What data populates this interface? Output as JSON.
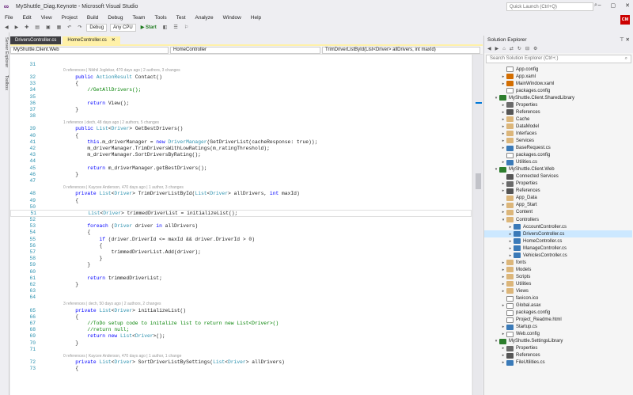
{
  "window": {
    "title": "MyShuttle_Diag.Keynote - Microsoft Visual Studio",
    "quick_launch_placeholder": "Quick Launch (Ctrl+Q)",
    "user_initials": "CM"
  },
  "menu": [
    "File",
    "Edit",
    "View",
    "Project",
    "Build",
    "Debug",
    "Team",
    "Tools",
    "Test",
    "Analyze",
    "Window",
    "Help"
  ],
  "toolbar": {
    "config": "Debug",
    "platform": "Any CPU",
    "start_label": "Start"
  },
  "side_tabs": [
    "Server Explorer",
    "Toolbox"
  ],
  "tabs": [
    {
      "label": "DriversController.cs",
      "active": false
    },
    {
      "label": "HomeController.cs",
      "active": true
    }
  ],
  "navbar": {
    "project": "MyShuttle.Client.Web",
    "class": "HomeController",
    "member": "TrimDriverListById(List<Driver> allDrivers, int maxId)"
  },
  "code": [
    {
      "n": "31",
      "t": ""
    },
    {
      "lens": "0 references | Nikhil Joglekar, 470 days ago | 2 authors, 3 changes"
    },
    {
      "n": "32",
      "t": "        public ActionResult Contact()"
    },
    {
      "n": "33",
      "t": "        {"
    },
    {
      "n": "34",
      "t": "            //GetAllDrivers();"
    },
    {
      "n": "35",
      "t": ""
    },
    {
      "n": "36",
      "t": "            return View();"
    },
    {
      "n": "37",
      "t": "        }"
    },
    {
      "n": "38",
      "t": ""
    },
    {
      "lens": "1 reference | dech, 48 days ago | 2 authors, 5 changes"
    },
    {
      "n": "39",
      "t": "        public List<Driver> GetBestDrivers()"
    },
    {
      "n": "40",
      "t": "        {"
    },
    {
      "n": "41",
      "t": "            this.m_driverManager = new DriverManager(GetDriverList(cacheResponse: true));"
    },
    {
      "n": "42",
      "t": "            m_driverManager.TrimDriversWithLowRatings(m_ratingThreshold);"
    },
    {
      "n": "43",
      "t": "            m_driverManager.SortDriversByRating();"
    },
    {
      "n": "44",
      "t": ""
    },
    {
      "n": "45",
      "t": "            return m_driverManager.getBestDrivers();"
    },
    {
      "n": "46",
      "t": "        }"
    },
    {
      "n": "47",
      "t": ""
    },
    {
      "lens": "0 references | Kaycee Anderson, 470 days ago | 1 author, 3 changes"
    },
    {
      "n": "48",
      "t": "        private List<Driver> TrimDriverListById(List<Driver> allDrivers, int maxId)"
    },
    {
      "n": "49",
      "t": "        {"
    },
    {
      "n": "50",
      "t": ""
    },
    {
      "n": "51",
      "t": "            List<Driver> trimmedDriverList = initializeList();"
    },
    {
      "n": "52",
      "t": ""
    },
    {
      "n": "53",
      "t": "            foreach (Driver driver in allDrivers)"
    },
    {
      "n": "54",
      "t": "            {"
    },
    {
      "n": "55",
      "t": "                if (driver.DriverId <= maxId && driver.DriverId > 0)"
    },
    {
      "n": "56",
      "t": "                {"
    },
    {
      "n": "57",
      "t": "                    trimmedDriverList.Add(driver);"
    },
    {
      "n": "58",
      "t": "                }"
    },
    {
      "n": "59",
      "t": "            }"
    },
    {
      "n": "60",
      "t": ""
    },
    {
      "n": "61",
      "t": "            return trimmedDriverList;"
    },
    {
      "n": "62",
      "t": "        }"
    },
    {
      "n": "63",
      "t": ""
    },
    {
      "n": "64",
      "t": ""
    },
    {
      "lens": "3 references | dech, 50 days ago | 2 authors, 2 changes"
    },
    {
      "n": "65",
      "t": "        private List<Driver> initializeList()"
    },
    {
      "n": "66",
      "t": "        {"
    },
    {
      "n": "67",
      "t": "            //ToDo setup code to initalize list to return new List<Driver>()"
    },
    {
      "n": "68",
      "t": "            //return null;"
    },
    {
      "n": "69",
      "t": "            return new List<Driver>();"
    },
    {
      "n": "70",
      "t": "        }"
    },
    {
      "n": "71",
      "t": ""
    },
    {
      "lens": "0 references | Kaycee Anderson, 470 days ago | 1 author, 1 change"
    },
    {
      "n": "72",
      "t": "        private List<Driver> SortDriverListBySettings(List<Driver> allDrivers)"
    },
    {
      "n": "73",
      "t": "        {"
    }
  ],
  "solution_explorer": {
    "title": "Solution Explorer",
    "search_placeholder": "Search Solution Explorer (Ctrl+;)",
    "items": [
      {
        "label": "App.config",
        "d": 2,
        "tw": "",
        "ic": "file"
      },
      {
        "label": "App.xaml",
        "d": 2,
        "tw": "▸",
        "ic": "xml"
      },
      {
        "label": "MainWindow.xaml",
        "d": 2,
        "tw": "▸",
        "ic": "xml"
      },
      {
        "label": "packages.config",
        "d": 2,
        "tw": "",
        "ic": "file"
      },
      {
        "label": "MyShuttle.Client.SharedLibrary",
        "d": 1,
        "tw": "▾",
        "ic": "proj"
      },
      {
        "label": "Properties",
        "d": 2,
        "tw": "▸",
        "ic": "prop"
      },
      {
        "label": "References",
        "d": 2,
        "tw": "▸",
        "ic": "ref"
      },
      {
        "label": "Cache",
        "d": 2,
        "tw": "▸",
        "ic": "folder"
      },
      {
        "label": "DataModel",
        "d": 2,
        "tw": "▸",
        "ic": "folder"
      },
      {
        "label": "Interfaces",
        "d": 2,
        "tw": "▸",
        "ic": "folder"
      },
      {
        "label": "Services",
        "d": 2,
        "tw": "▸",
        "ic": "folder"
      },
      {
        "label": "BaseRequest.cs",
        "d": 2,
        "tw": "▸",
        "ic": "cs"
      },
      {
        "label": "packages.config",
        "d": 2,
        "tw": "",
        "ic": "file"
      },
      {
        "label": "Utilities.cs",
        "d": 2,
        "tw": "▸",
        "ic": "cs"
      },
      {
        "label": "MyShuttle.Client.Web",
        "d": 1,
        "tw": "▾",
        "ic": "proj"
      },
      {
        "label": "Connected Services",
        "d": 2,
        "tw": "",
        "ic": "ref"
      },
      {
        "label": "Properties",
        "d": 2,
        "tw": "▸",
        "ic": "prop"
      },
      {
        "label": "References",
        "d": 2,
        "tw": "▸",
        "ic": "ref"
      },
      {
        "label": "App_Data",
        "d": 2,
        "tw": "",
        "ic": "folder"
      },
      {
        "label": "App_Start",
        "d": 2,
        "tw": "▸",
        "ic": "folder"
      },
      {
        "label": "Content",
        "d": 2,
        "tw": "▸",
        "ic": "folder"
      },
      {
        "label": "Controllers",
        "d": 2,
        "tw": "▾",
        "ic": "folder"
      },
      {
        "label": "AccountController.cs",
        "d": 3,
        "tw": "▸",
        "ic": "cs"
      },
      {
        "label": "DriversController.cs",
        "d": 3,
        "tw": "▸",
        "ic": "cs",
        "sel": true
      },
      {
        "label": "HomeController.cs",
        "d": 3,
        "tw": "▸",
        "ic": "cs"
      },
      {
        "label": "ManageController.cs",
        "d": 3,
        "tw": "▸",
        "ic": "cs"
      },
      {
        "label": "VehiclesController.cs",
        "d": 3,
        "tw": "▸",
        "ic": "cs"
      },
      {
        "label": "fonts",
        "d": 2,
        "tw": "▸",
        "ic": "folder"
      },
      {
        "label": "Models",
        "d": 2,
        "tw": "▸",
        "ic": "folder"
      },
      {
        "label": "Scripts",
        "d": 2,
        "tw": "▸",
        "ic": "folder"
      },
      {
        "label": "Utilities",
        "d": 2,
        "tw": "▸",
        "ic": "folder"
      },
      {
        "label": "Views",
        "d": 2,
        "tw": "▸",
        "ic": "folder"
      },
      {
        "label": "favicon.ico",
        "d": 2,
        "tw": "",
        "ic": "file"
      },
      {
        "label": "Global.asax",
        "d": 2,
        "tw": "▸",
        "ic": "file"
      },
      {
        "label": "packages.config",
        "d": 2,
        "tw": "",
        "ic": "file"
      },
      {
        "label": "Project_Readme.html",
        "d": 2,
        "tw": "",
        "ic": "file"
      },
      {
        "label": "Startup.cs",
        "d": 2,
        "tw": "▸",
        "ic": "cs"
      },
      {
        "label": "Web.config",
        "d": 2,
        "tw": "▸",
        "ic": "file"
      },
      {
        "label": "MyShuttle.SettingsLibrary",
        "d": 1,
        "tw": "▾",
        "ic": "proj"
      },
      {
        "label": "Properties",
        "d": 2,
        "tw": "▸",
        "ic": "prop"
      },
      {
        "label": "References",
        "d": 2,
        "tw": "▸",
        "ic": "ref"
      },
      {
        "label": "FileUtilities.cs",
        "d": 2,
        "tw": "▸",
        "ic": "cs"
      }
    ]
  },
  "colors": {
    "accent": "#68217a",
    "active_tab": "#fff1a8",
    "keyword": "#0000ff",
    "type": "#2b91af",
    "comment": "#008000",
    "line_number": "#2b91af"
  }
}
